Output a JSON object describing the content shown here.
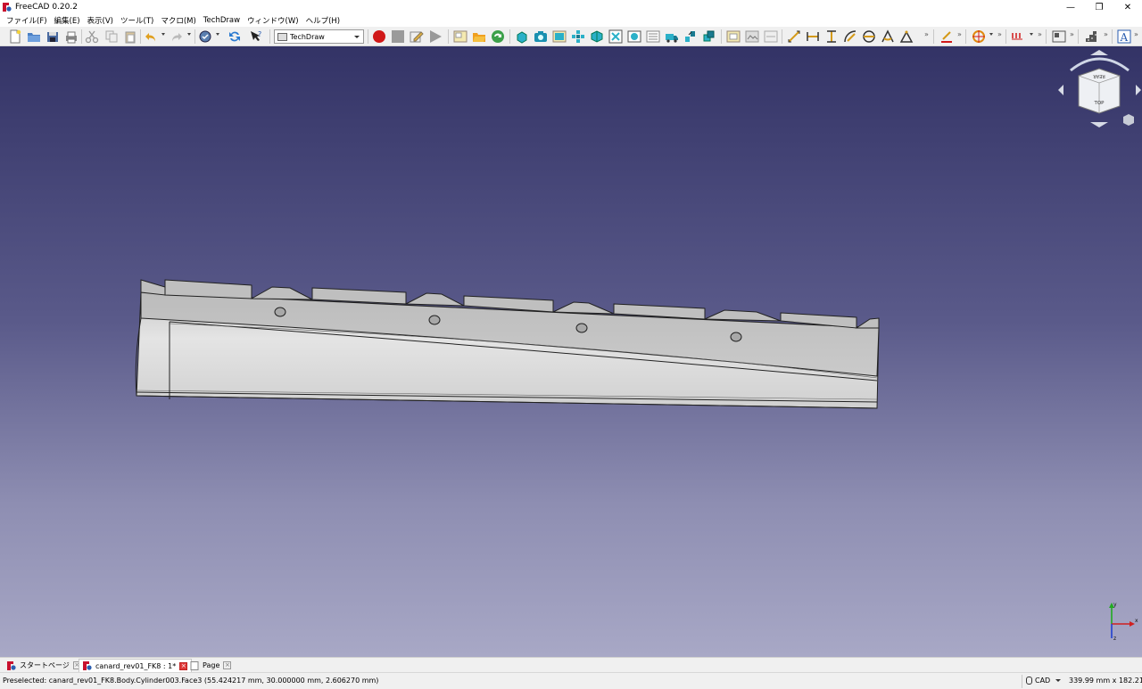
{
  "window": {
    "title": "FreeCAD 0.20.2",
    "minimize": "—",
    "restore": "❐",
    "close": "✕"
  },
  "menu": [
    "ファイル(F)",
    "編集(E)",
    "表示(V)",
    "ツール(T)",
    "マクロ(M)",
    "TechDraw",
    "ウィンドウ(W)",
    "ヘルプ(H)"
  ],
  "toolbar": {
    "workbench": "TechDraw",
    "chevron": "»"
  },
  "navcube": {
    "top_face": "TOP",
    "rear_face": "REAR"
  },
  "axis": {
    "x": "x",
    "y": "y",
    "z": "z"
  },
  "tabs": [
    {
      "label": "スタートページ",
      "active": false
    },
    {
      "label": "canard_rev01_FK8 : 1*",
      "active": true
    },
    {
      "label": "Page",
      "active": false
    }
  ],
  "status": {
    "message": "Preselected: canard_rev01_FK8.Body.Cylinder003.Face3 (55.424217 mm, 30.000000 mm, 2.606270 mm)",
    "navigation_style": "CAD",
    "dimensions": "339.99 mm x 182.21 mm"
  }
}
